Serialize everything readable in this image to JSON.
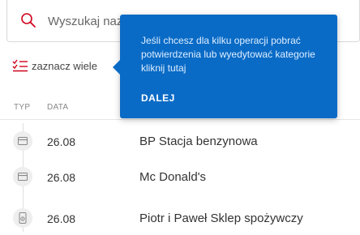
{
  "search": {
    "placeholder": "Wyszukaj nazwę",
    "icon": "search-icon",
    "icon_color": "#d0021b"
  },
  "select_many": {
    "label": "zaznacz wiele",
    "icon": "checklist-icon",
    "icon_color": "#d0021b"
  },
  "columns": {
    "type": "TYP",
    "date": "DATA"
  },
  "transactions": [
    {
      "icon": "card-icon",
      "date": "26.08",
      "name": "BP Stacja benzynowa"
    },
    {
      "icon": "card-icon",
      "date": "26.08",
      "name": "Mc Donald's"
    },
    {
      "icon": "phone-payment-icon",
      "date": "26.08",
      "name": "Piotr i Paweł Sklep spożywczy"
    }
  ],
  "tooltip": {
    "text": "Jeśli chcesz dla kilku operacji pobrać potwierdzenia lub wyedytować kategorie kliknij tutaj",
    "button_label": "DALEJ",
    "background": "#0a6bc6"
  }
}
